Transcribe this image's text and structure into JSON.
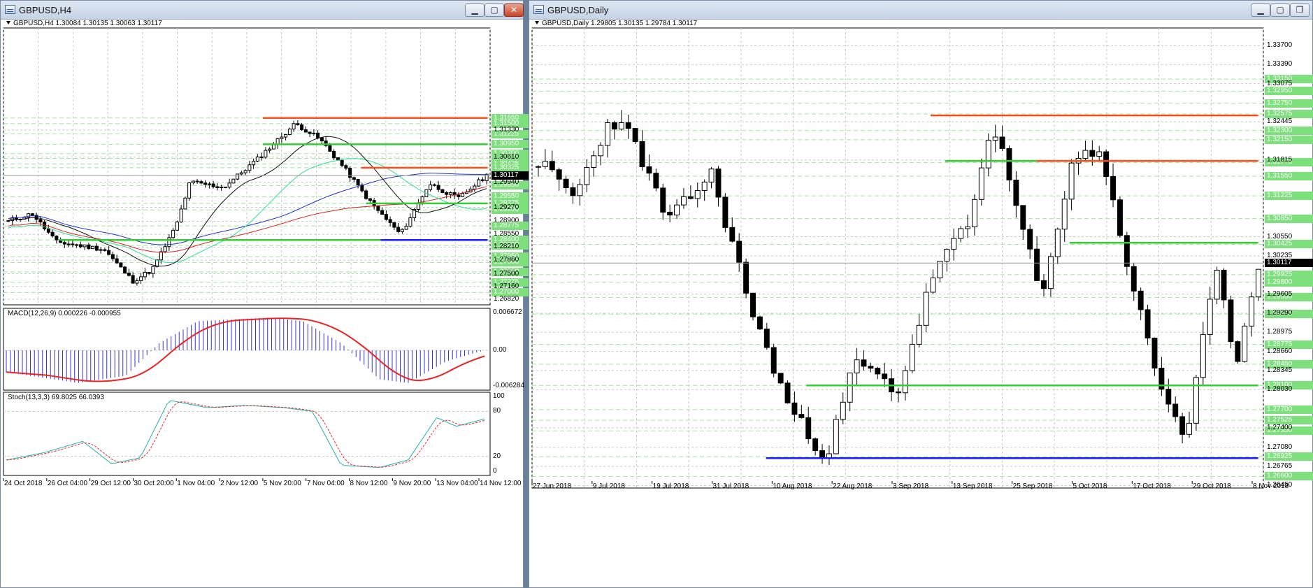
{
  "left": {
    "title": "GBPUSD,H4",
    "price_header": "GBPUSD,H4  1.30084 1.30135 1.30063 1.30117",
    "macd_header": "MACD(12,26,9) 0.000226 -0.000955",
    "stoch_header": "Stoch(13,3,3) 69.8025 66.0393",
    "price_axis": {
      "min": 1.2682,
      "max": 1.339,
      "ticks": [
        "1.31330",
        "1.30610",
        "1.29940",
        "1.29270",
        "1.28900",
        "1.28550",
        "1.28210",
        "1.27860",
        "1.27500",
        "1.27160",
        "1.26820"
      ],
      "tick_values": [
        1.3133,
        1.3061,
        1.2994,
        1.2927,
        1.289,
        1.2855,
        1.2821,
        1.2786,
        1.275,
        1.2716,
        1.2682
      ],
      "levels": [
        "1.31650",
        "1.31500",
        "1.31225",
        "1.30950",
        "1.30700",
        "1.30575",
        "1.30425",
        "1.30325",
        "1.29850",
        "1.29550",
        "1.29375",
        "1.29200",
        "1.28775",
        "1.28400",
        "1.28250",
        "1.27950",
        "1.27800",
        "1.27550",
        "1.27275",
        "1.27000"
      ],
      "level_values": [
        1.3165,
        1.315,
        1.31225,
        1.3095,
        1.307,
        1.30575,
        1.30425,
        1.30325,
        1.2985,
        1.2955,
        1.29375,
        1.292,
        1.28775,
        1.284,
        1.2825,
        1.2795,
        1.278,
        1.2755,
        1.27275,
        1.27
      ],
      "current": "1.30117",
      "current_value": 1.30117
    },
    "macd_axis": [
      "0.006672",
      "0.00",
      "-0.006284"
    ],
    "stoch_axis": [
      "100",
      "80",
      "20",
      "0"
    ],
    "time_labels": [
      "24 Oct 2018",
      "26 Oct 04:00",
      "29 Oct 12:00",
      "30 Oct 20:00",
      "1 Nov 04:00",
      "2 Nov 12:00",
      "5 Nov 20:00",
      "7 Nov 04:00",
      "8 Nov 12:00",
      "9 Nov 20:00",
      "13 Nov 04:00",
      "14 Nov 12:00"
    ],
    "hlines": [
      {
        "price": 1.3165,
        "x0": 0.533,
        "x1": 0.995,
        "color": "#ff4d1a"
      },
      {
        "price": 1.3095,
        "x0": 0.533,
        "x1": 0.995,
        "color": "#33cc33"
      },
      {
        "price": 1.30325,
        "x0": 0.735,
        "x1": 0.995,
        "color": "#ff4d1a"
      },
      {
        "price": 1.29375,
        "x0": 0.745,
        "x1": 0.995,
        "color": "#33cc33"
      },
      {
        "price": 1.284,
        "x0": 0.115,
        "x1": 0.775,
        "color": "#33cc33"
      },
      {
        "price": 1.284,
        "x0": 0.775,
        "x1": 0.995,
        "color": "#1a1aff"
      }
    ]
  },
  "right": {
    "title": "GBPUSD,Daily",
    "price_header": "GBPUSD,Daily  1.29805 1.30135 1.29784 1.30117",
    "price_axis": {
      "min": 1.265,
      "max": 1.339,
      "ticks": [
        "1.33700",
        "1.33390",
        "1.33075",
        "1.32445",
        "1.31815",
        "1.30550",
        "1.30235",
        "1.29605",
        "1.29290",
        "1.28975",
        "1.28660",
        "1.28345",
        "1.28030",
        "1.27400",
        "1.27080",
        "1.26765",
        "1.26450"
      ],
      "tick_values": [
        1.337,
        1.3339,
        1.33075,
        1.32445,
        1.31815,
        1.3055,
        1.30235,
        1.29605,
        1.2929,
        1.28975,
        1.2866,
        1.28345,
        1.2803,
        1.274,
        1.2708,
        1.26765,
        1.2645
      ],
      "levels": [
        "1.33150",
        "1.32950",
        "1.32750",
        "1.32575",
        "1.32300",
        "1.32150",
        "1.31775",
        "1.31550",
        "1.31225",
        "1.30850",
        "1.30425",
        "1.29925",
        "1.29800",
        "1.29550",
        "1.29275",
        "1.28775",
        "1.28450",
        "1.28100",
        "1.27700",
        "1.27525",
        "1.27350",
        "1.26925",
        "1.26600"
      ],
      "level_values": [
        1.3315,
        1.3295,
        1.3275,
        1.32575,
        1.323,
        1.3215,
        1.31775,
        1.3155,
        1.31225,
        1.3085,
        1.30425,
        1.29925,
        1.298,
        1.2955,
        1.29275,
        1.28775,
        1.2845,
        1.281,
        1.277,
        1.27525,
        1.2735,
        1.26925,
        1.266
      ],
      "current": "1.30117",
      "current_value": 1.30117
    },
    "time_labels": [
      "27 Jun 2018",
      "9 Jul 2018",
      "19 Jul 2018",
      "31 Jul 2018",
      "10 Aug 2018",
      "22 Aug 2018",
      "3 Sep 2018",
      "13 Sep 2018",
      "25 Sep 2018",
      "5 Oct 2018",
      "17 Oct 2018",
      "29 Oct 2018",
      "8 Nov 2018"
    ],
    "hlines": [
      {
        "price": 1.3255,
        "x0": 0.545,
        "x1": 0.993,
        "color": "#ff4d1a"
      },
      {
        "price": 1.318,
        "x0": 0.69,
        "x1": 0.993,
        "color": "#ff4d1a"
      },
      {
        "price": 1.318,
        "x0": 0.565,
        "x1": 0.69,
        "color": "#33cc33"
      },
      {
        "price": 1.3045,
        "x0": 0.735,
        "x1": 0.993,
        "color": "#33cc33"
      },
      {
        "price": 1.281,
        "x0": 0.375,
        "x1": 0.993,
        "color": "#33cc33"
      },
      {
        "price": 1.269,
        "x0": 0.32,
        "x1": 0.993,
        "color": "#1a1aff"
      }
    ]
  },
  "colors": {
    "bull": "#ffffff",
    "bear": "#000000",
    "grid": "#c8c8c8",
    "level_bg": "#7de07d",
    "macd_hist": "#3333dd",
    "macd_signal": "#ee2222",
    "stoch_main": "#20b2aa",
    "stoch_signal": "#ee2222",
    "ma_blue": "#2233cc",
    "ma_red": "#dd2222",
    "ma_green": "#33dd99",
    "ma_black": "#111111"
  }
}
